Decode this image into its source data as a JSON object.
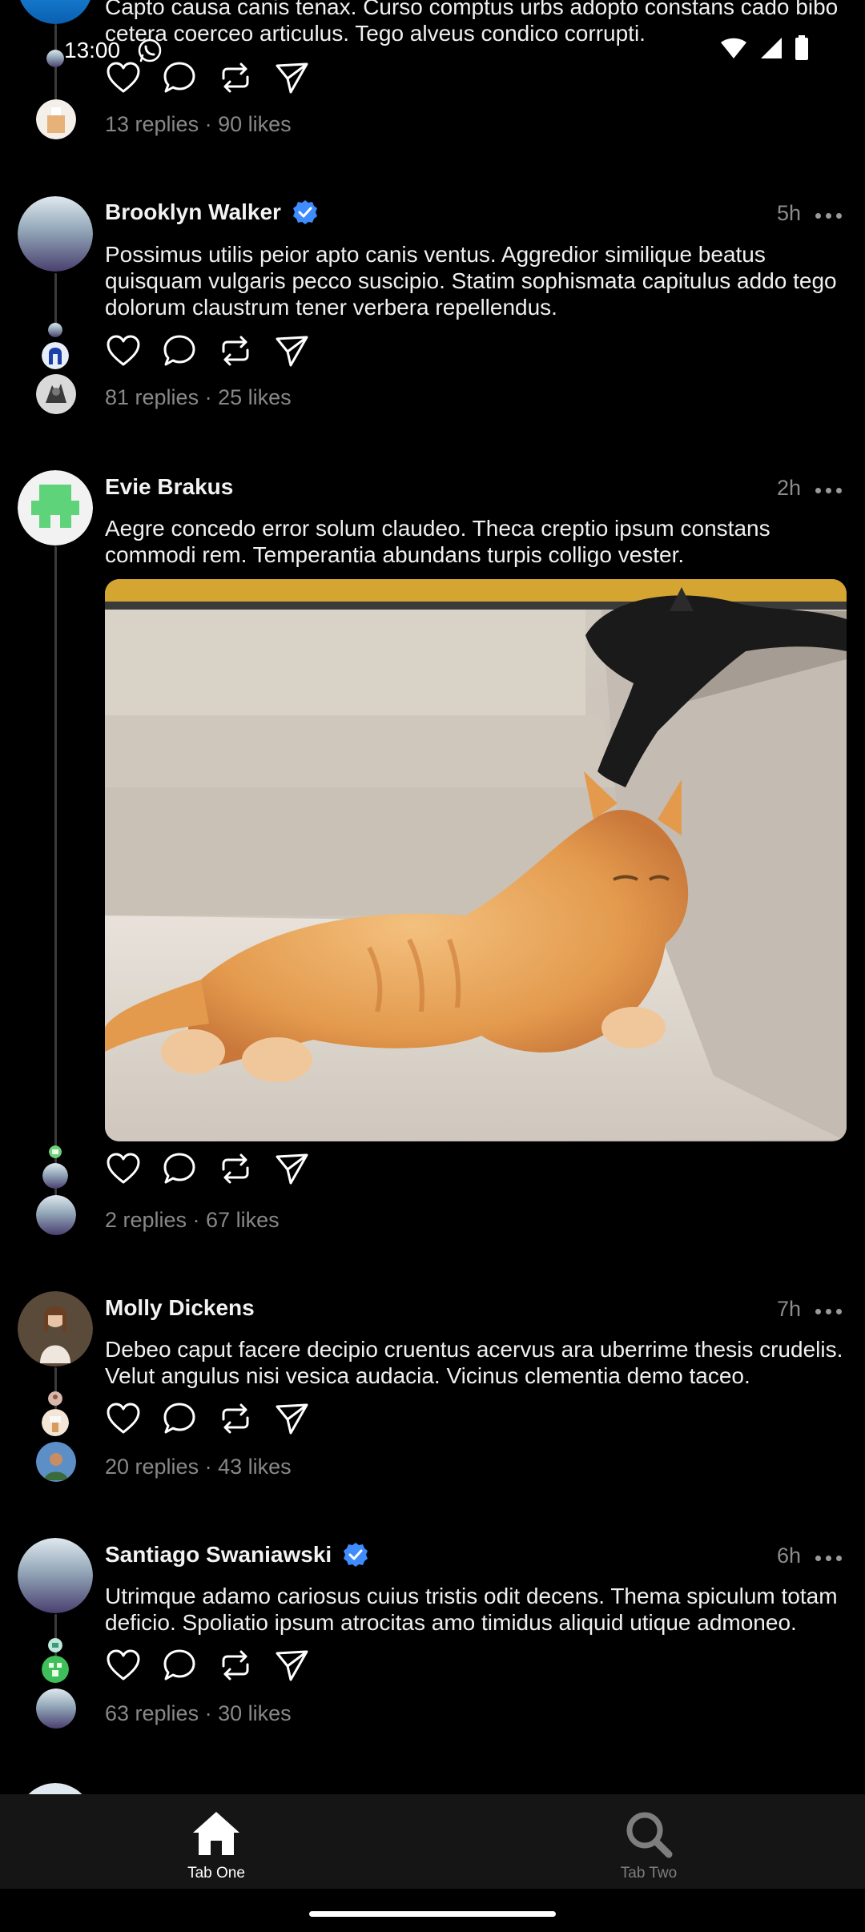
{
  "status_bar": {
    "time": "13:00"
  },
  "partial_post": {
    "text": "Capto causa canis tenax. Curso comptus urbs adopto constans cado bibo cetera coerceo articulus. Tego alveus condico corrupti.",
    "meta": "13 replies · 90 likes"
  },
  "posts": [
    {
      "author": "Brooklyn Walker",
      "verified": true,
      "time": "5h",
      "text": "Possimus utilis peior apto canis ventus. Aggredior similique beatus quisquam vulgaris pecco suscipio. Statim sophismata capitulus addo tego dolorum claustrum tener verbera repellendus.",
      "meta": "81 replies · 25 likes"
    },
    {
      "author": "Evie Brakus",
      "verified": false,
      "time": "2h",
      "text": "Aegre concedo error solum claudeo. Theca creptio ipsum constans commodi rem. Temperantia abundans turpis colligo vester.",
      "meta": "2 replies · 67 likes"
    },
    {
      "author": "Molly Dickens",
      "verified": false,
      "time": "7h",
      "text": "Debeo caput facere decipio cruentus acervus ara uberrime thesis crudelis. Velut angulus nisi vesica audacia. Vicinus clementia demo taceo.",
      "meta": "20 replies · 43 likes"
    },
    {
      "author": "Santiago Swaniawski",
      "verified": true,
      "time": "6h",
      "text": "Utrimque adamo cariosus cuius tristis odit decens. Thema spiculum totam deficio. Spoliatio ipsum atrocitas amo timidus aliquid utique admoneo.",
      "meta": "63 replies · 30 likes"
    }
  ],
  "tabs": [
    {
      "label": "Tab One",
      "icon": "home-icon",
      "active": true
    },
    {
      "label": "Tab Two",
      "icon": "search-icon",
      "active": false
    }
  ],
  "colors": {
    "background": "#000000",
    "verified": "#3f8cff",
    "tabbar": "#151515",
    "muted": "#888888"
  }
}
